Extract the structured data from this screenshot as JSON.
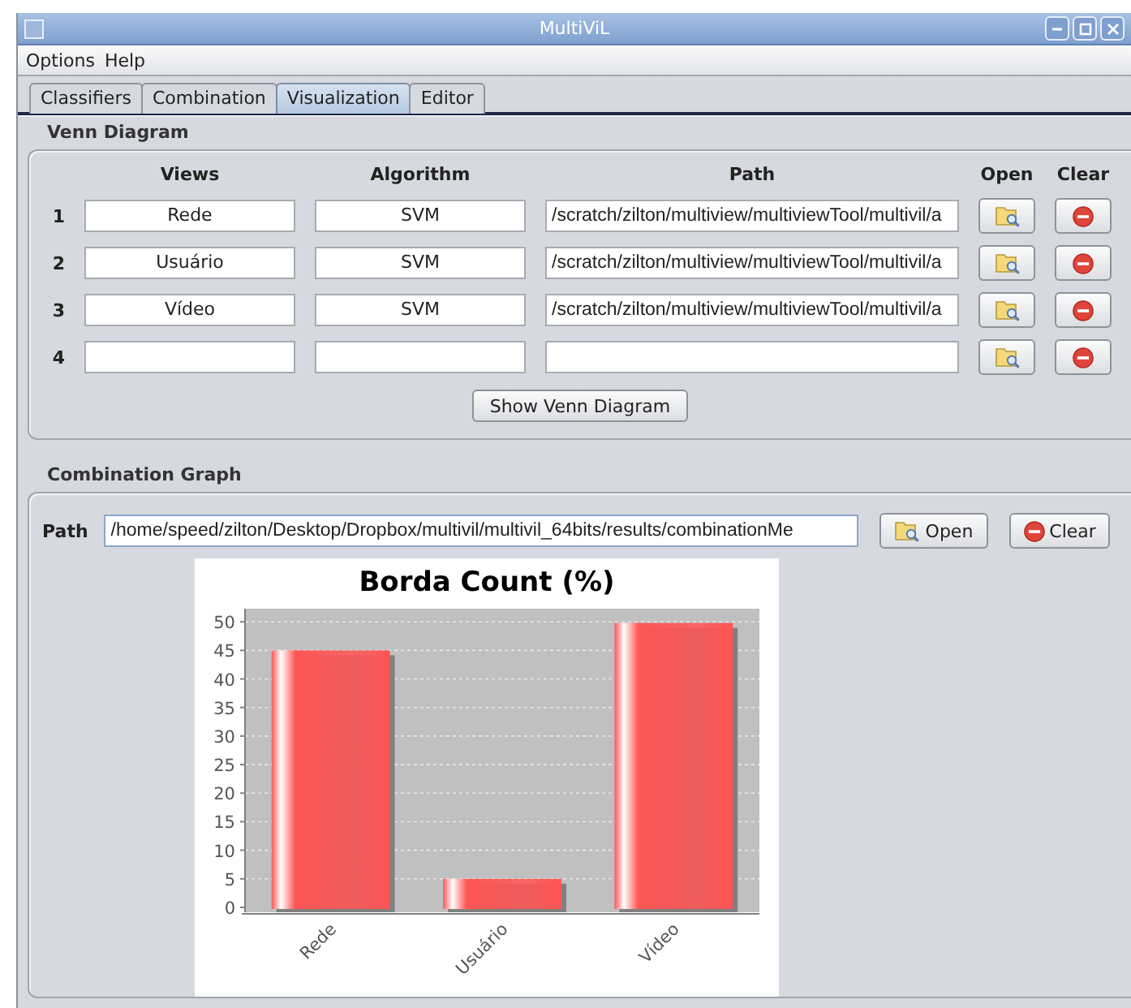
{
  "window": {
    "title": "MultiViL"
  },
  "menu": [
    "Options",
    "Help"
  ],
  "tabs": [
    {
      "label": "Classifiers",
      "selected": false
    },
    {
      "label": "Combination",
      "selected": false
    },
    {
      "label": "Visualization",
      "selected": true
    },
    {
      "label": "Editor",
      "selected": false
    }
  ],
  "venn_diagram": {
    "title": "Venn Diagram",
    "columns": [
      "Views",
      "Algorithm",
      "Path",
      "Open",
      "Clear"
    ],
    "rows": [
      {
        "number": "1",
        "view": "Rede",
        "algorithm": "SVM",
        "path": "/scratch/zilton/multiview/multiviewTool/multivil/a"
      },
      {
        "number": "2",
        "view": "Usuário",
        "algorithm": "SVM",
        "path": "/scratch/zilton/multiview/multiviewTool/multivil/a"
      },
      {
        "number": "3",
        "view": "Vídeo",
        "algorithm": "SVM",
        "path": "/scratch/zilton/multiview/multiviewTool/multivil/a"
      },
      {
        "number": "4"
      }
    ],
    "button": "Show Venn Diagram"
  },
  "combination_graph": {
    "title": "Combination Graph",
    "path_label": "Path",
    "path": "/home/speed/zilton/Desktop/Dropbox/multivil/multivil_64bits/results/combinationMe",
    "buttons": [
      {
        "kind": "open",
        "label": "Open"
      },
      {
        "kind": "clear",
        "label": "Clear"
      }
    ],
    "chart_data": {
      "type": "bar",
      "title": "Borda Count (%)",
      "categories": [
        "Rede",
        "Usuário",
        "Vídeo"
      ],
      "series": [
        {
          "color": "#ff5555",
          "values": [
            45,
            5,
            49.8
          ]
        }
      ],
      "ylim": [
        0,
        52.3
      ],
      "grid": true,
      "yticks": [
        0,
        5,
        10,
        15,
        20,
        25,
        30,
        35,
        40,
        45,
        50
      ]
    }
  }
}
